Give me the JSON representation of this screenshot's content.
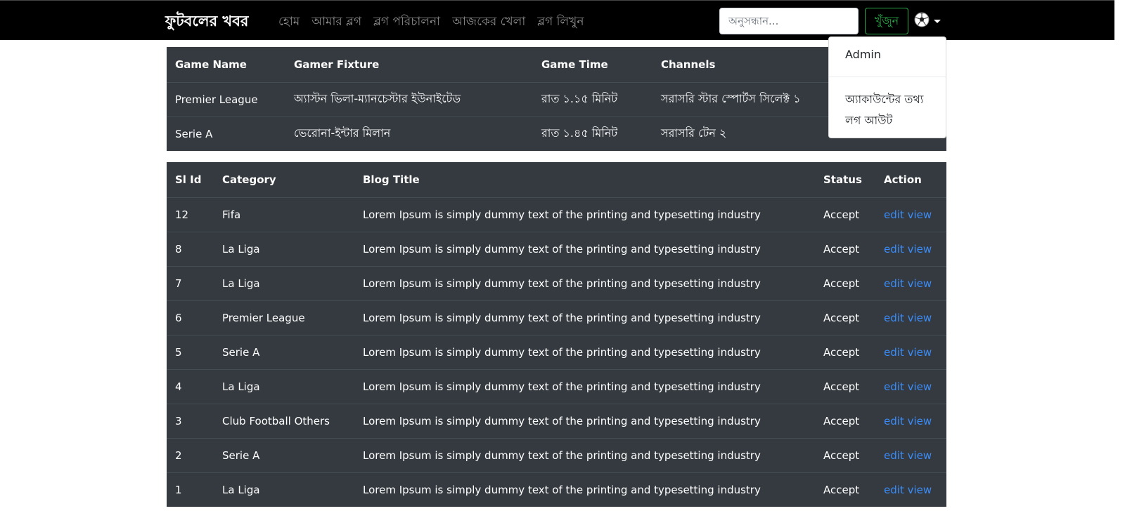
{
  "navbar": {
    "brand": "ফুটবলের খবর",
    "links": [
      "হোম",
      "আমার ব্লগ",
      "ব্লগ পরিচালনা",
      "আজকের খেলা",
      "ব্লগ লিখুন"
    ],
    "search_placeholder": "অনুসন্ধান...",
    "search_button": "খুঁজুন",
    "user_icon": "soccer-ball-icon"
  },
  "dropdown": {
    "title": "Admin",
    "items": [
      "অ্যাকাউন্টের তথ্য",
      "লগ আউট"
    ]
  },
  "fixtures": {
    "headers": [
      "Game Name",
      "Gamer Fixture",
      "Game Time",
      "Channels"
    ],
    "rows": [
      [
        "Premier League",
        "অ্যাস্টন ভিলা-ম্যানচেস্টার ইউনাইটেড",
        "রাত ১.১৫ মিনিট",
        "সরাসরি স্টার স্পোর্টস সিলেক্ট ১"
      ],
      [
        "Serie A",
        "ভেরোনা-ইন্টার মিলান",
        "রাত ১.৪৫ মিনিট",
        "সরাসরি টেন ২"
      ]
    ]
  },
  "blogs": {
    "headers": [
      "Sl Id",
      "Category",
      "Blog Title",
      "Status",
      "Action"
    ],
    "edit_label": "edit",
    "view_label": "view",
    "rows": [
      [
        "12",
        "Fifa",
        "Lorem Ipsum is simply dummy text of the printing and typesetting industry",
        "Accept"
      ],
      [
        "8",
        "La Liga",
        "Lorem Ipsum is simply dummy text of the printing and typesetting industry",
        "Accept"
      ],
      [
        "7",
        "La Liga",
        "Lorem Ipsum is simply dummy text of the printing and typesetting industry",
        "Accept"
      ],
      [
        "6",
        "Premier League",
        "Lorem Ipsum is simply dummy text of the printing and typesetting industry",
        "Accept"
      ],
      [
        "5",
        "Serie A",
        "Lorem Ipsum is simply dummy text of the printing and typesetting industry",
        "Accept"
      ],
      [
        "4",
        "La Liga",
        "Lorem Ipsum is simply dummy text of the printing and typesetting industry",
        "Accept"
      ],
      [
        "3",
        "Club Football Others",
        "Lorem Ipsum is simply dummy text of the printing and typesetting industry",
        "Accept"
      ],
      [
        "2",
        "Serie A",
        "Lorem Ipsum is simply dummy text of the printing and typesetting industry",
        "Accept"
      ],
      [
        "1",
        "La Liga",
        "Lorem Ipsum is simply dummy text of the printing and typesetting industry",
        "Accept"
      ]
    ]
  },
  "colors": {
    "navbar_bg": "#000000",
    "table_bg": "#343a40",
    "link": "#3b8cf7",
    "success": "#28a745"
  }
}
